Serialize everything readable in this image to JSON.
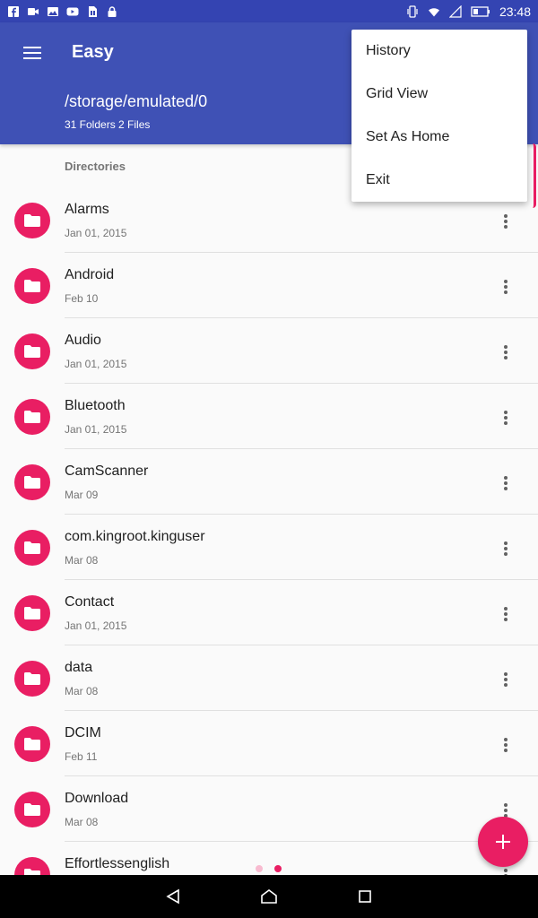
{
  "status_bar": {
    "time": "23:48",
    "left_icons": [
      "facebook-icon",
      "video-icon",
      "image-icon",
      "youtube-icon",
      "sim-icon",
      "lock-icon"
    ],
    "right_icons": [
      "vibrate-icon",
      "wifi-icon",
      "signal-icon",
      "battery-icon"
    ]
  },
  "app_bar": {
    "title": "Easy",
    "path": "/storage/emulated/0",
    "summary": "31 Folders 2 Files",
    "menu_icon": "hamburger-icon"
  },
  "section": {
    "label": "Directories"
  },
  "items": [
    {
      "name": "Alarms",
      "date": "Jan 01, 2015"
    },
    {
      "name": "Android",
      "date": "Feb 10"
    },
    {
      "name": "Audio",
      "date": "Jan 01, 2015"
    },
    {
      "name": "Bluetooth",
      "date": "Jan 01, 2015"
    },
    {
      "name": "CamScanner",
      "date": "Mar 09"
    },
    {
      "name": "com.kingroot.kinguser",
      "date": "Mar 08"
    },
    {
      "name": "Contact",
      "date": "Jan 01, 2015"
    },
    {
      "name": "data",
      "date": "Mar 08"
    },
    {
      "name": "DCIM",
      "date": "Feb 11"
    },
    {
      "name": "Download",
      "date": "Mar 08"
    },
    {
      "name": "Effortlessenglish",
      "date": ""
    }
  ],
  "overflow_menu": {
    "items": [
      "History",
      "Grid View",
      "Set As Home",
      "Exit"
    ]
  },
  "fab": {
    "icon": "plus-icon"
  },
  "pager": {
    "count": 2,
    "active_index": 1
  },
  "nav_bar": {
    "icons": [
      "back-icon",
      "home-icon",
      "recents-icon"
    ]
  },
  "colors": {
    "primary": "#3f51b5",
    "primary_dark": "#3444b2",
    "accent": "#e91e63"
  }
}
